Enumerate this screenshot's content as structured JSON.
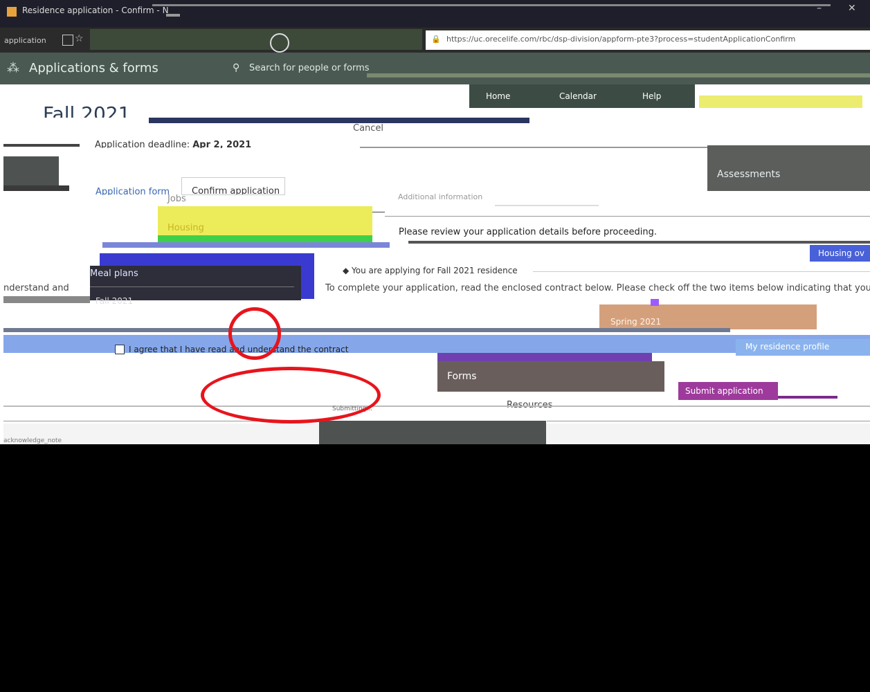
{
  "browser": {
    "tab_title": "Residence application - Confirm - N",
    "url": "https://uc.orecelife.com/rbc/dsp-division/appform-pte3?process=studentApplicationConfirm",
    "address_left": "application"
  },
  "app": {
    "title": "Applications & forms",
    "search_placeholder": "Search for people or forms",
    "nav": {
      "home": "Home",
      "calendar": "Calendar",
      "help": "Help"
    }
  },
  "page": {
    "term_title": "Fall 2021",
    "deadline_label": "Application deadline:",
    "deadline_value": "Apr 2, 2021",
    "cancel": "Cancel",
    "tabs": [
      "Application form",
      "Confirm application"
    ],
    "review_text": "Please review your application details before proceeding.",
    "applying_for": "You are applying for Fall 2021 residence",
    "instructions": "To complete your application, read the enclosed contract below. Please check off the two items below indicating that you u",
    "instructions_left": "nderstand and",
    "agree_text": "I agree that I have read and understand the contract",
    "submit": "Submit application",
    "footer_status": "Submitting...",
    "ack_left": "acknowledge_note"
  },
  "menu": {
    "items": [
      "Jobs",
      "Housing",
      "Meal plans",
      "Forms",
      "Resources",
      "Assessments"
    ],
    "terms": [
      "Fall 2021",
      "Spring 2021"
    ],
    "right_buttons": [
      "Housing ov",
      "My residence profile"
    ]
  },
  "colors": {
    "annotation": "#e8141c",
    "yellow": "#e8e84a",
    "purple": "#6a3aa0",
    "blue": "#3a5ad8",
    "salmon": "#d4a07c"
  }
}
